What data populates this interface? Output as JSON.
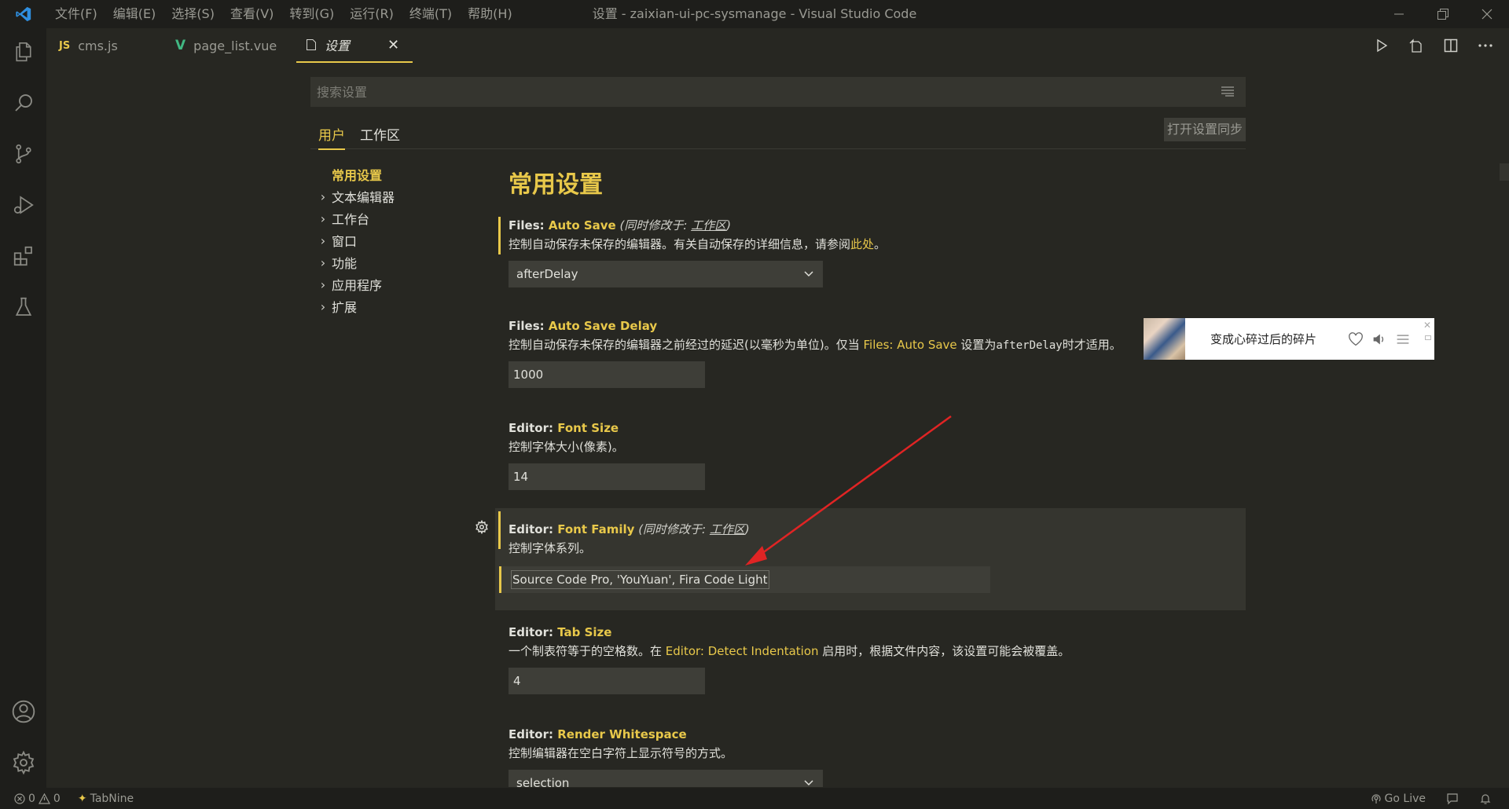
{
  "app": {
    "window_title": "设置 - zaixian-ui-pc-sysmanage - Visual Studio Code",
    "menus": [
      "文件(F)",
      "编辑(E)",
      "选择(S)",
      "查看(V)",
      "转到(G)",
      "运行(R)",
      "终端(T)",
      "帮助(H)"
    ]
  },
  "tabs": [
    {
      "icon": "JS",
      "label": "cms.js"
    },
    {
      "icon": "V",
      "label": "page_list.vue"
    },
    {
      "label": "设置",
      "close": "✕"
    }
  ],
  "search": {
    "placeholder": "搜索设置"
  },
  "scope": {
    "user": "用户",
    "workspace": "工作区",
    "sync_button": "打开设置同步"
  },
  "toc": [
    "常用设置",
    "文本编辑器",
    "工作台",
    "窗口",
    "功能",
    "应用程序",
    "扩展"
  ],
  "section_title": "常用设置",
  "settings": {
    "auto_save": {
      "category": "Files: ",
      "key": "Auto Save",
      "mod_prefix": " (同时修改于: ",
      "mod_scope": "工作区",
      "mod_suffix": ")",
      "desc": "控制自动保存未保存的编辑器。有关自动保存的详细信息，请参阅",
      "desc_link": "此处",
      "desc_end": "。",
      "value": "afterDelay"
    },
    "auto_save_delay": {
      "category": "Files: ",
      "key": "Auto Save Delay",
      "desc_a": "控制自动保存未保存的编辑器之前经过的延迟(以毫秒为单位)。仅当 ",
      "desc_link": "Files: Auto Save",
      "desc_b": " 设置为",
      "desc_code": "afterDelay",
      "desc_c": "时才适用。",
      "value": "1000"
    },
    "font_size": {
      "category": "Editor: ",
      "key": "Font Size",
      "desc": "控制字体大小(像素)。",
      "value": "14"
    },
    "font_family": {
      "category": "Editor: ",
      "key": "Font Family",
      "mod_prefix": " (同时修改于: ",
      "mod_scope": "工作区",
      "mod_suffix": ")",
      "desc": "控制字体系列。",
      "value": "Source Code Pro, 'YouYuan', Fira Code Light"
    },
    "tab_size": {
      "category": "Editor: ",
      "key": "Tab Size",
      "desc_a": "一个制表符等于的空格数。在 ",
      "desc_link": "Editor: Detect Indentation",
      "desc_b": " 启用时，根据文件内容，该设置可能会被覆盖。",
      "value": "4"
    },
    "render_whitespace": {
      "category": "Editor: ",
      "key": "Render Whitespace",
      "desc": "控制编辑器在空白字符上显示符号的方式。",
      "value": "selection"
    }
  },
  "popup": {
    "song": "变成心碎过后的碎片"
  },
  "statusbar": {
    "errors": "0",
    "warnings": "0",
    "tabnine": "TabNine",
    "golive": "Go Live"
  },
  "colors": {
    "accent": "#e8c84a",
    "background": "#272722",
    "sidebar": "#1e1e1b"
  }
}
